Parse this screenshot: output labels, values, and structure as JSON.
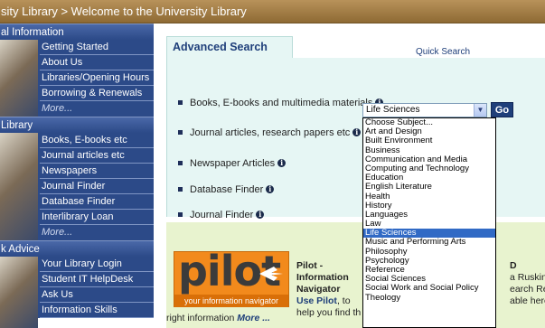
{
  "topbar": {
    "breadcrumb": "sity Library > Welcome to the University Library"
  },
  "sidebar": {
    "sections": [
      {
        "heading": "al Information",
        "items": [
          "Getting Started",
          "About Us",
          "Libraries/Opening Hours",
          "Borrowing & Renewals",
          "More..."
        ]
      },
      {
        "heading": "Library",
        "items": [
          "Books, E-books etc",
          "Journal articles etc",
          "Newspapers",
          "Journal Finder",
          "Database Finder",
          "Interlibrary Loan",
          "More..."
        ]
      },
      {
        "heading": "k Advice",
        "items": [
          "Your Library Login",
          "Student IT HelpDesk",
          "Ask Us",
          "Information Skills"
        ]
      }
    ]
  },
  "main": {
    "tab_active": "Advanced Search",
    "tab_quick": "Quick Search",
    "options": [
      {
        "label": "Books, E-books and multimedia materials"
      },
      {
        "label": "Journal articles, research papers etc"
      },
      {
        "label": "Newspaper Articles"
      },
      {
        "label": "Database Finder"
      },
      {
        "label": "Journal Finder"
      }
    ],
    "select_value": "Life Sciences",
    "go_label": "Go",
    "dropdown_options": [
      "Choose Subject...",
      "Art and Design",
      "Built Environment",
      "Business",
      "Communication and Media",
      "Computing and Technology",
      "Education",
      "English Literature",
      "Health",
      "History",
      "Languages",
      "Law",
      "Life Sciences",
      "Music and Performing Arts",
      "Philosophy",
      "Psychology",
      "Reference",
      "Social Sciences",
      "Social Work and Social Policy",
      "Theology"
    ],
    "dropdown_selected_index": 12,
    "info_glyph": "i"
  },
  "promo": {
    "logo_word": "pilot",
    "logo_tagline": "your information navigator",
    "text_line1": "Pilot -",
    "text_line2": "Information",
    "text_line3": "Navigator",
    "text_link": "Use Pilot",
    "text_line4_rest": ", to",
    "text_line5": "help you find th",
    "right_line1": "D",
    "right_line2": "a Ruskin",
    "right_line3": "earch Repos",
    "right_line4": "able here M",
    "bottom_text": "right information ",
    "bottom_more": "More ..."
  },
  "colors": {
    "accent": "#1f3f7a",
    "sidebar": "#2c4a88",
    "topbar": "#9c7840",
    "panel": "#e6f6f4",
    "promo": "#e8f3cf",
    "pilot_orange": "#f28a1c"
  }
}
